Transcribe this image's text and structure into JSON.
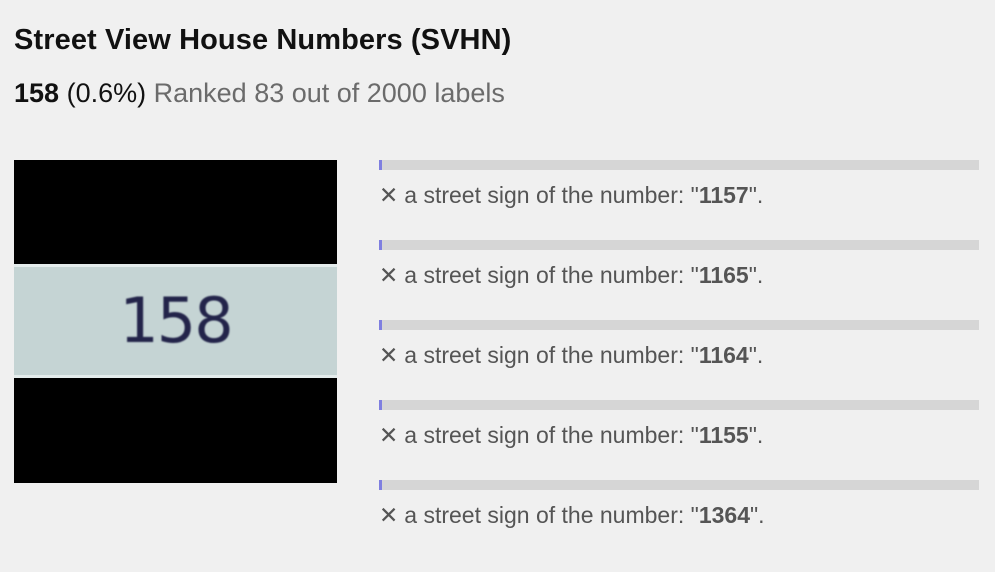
{
  "header": {
    "title": "Street View House Numbers (SVHN)",
    "label": "158",
    "percent": "(0.6%)",
    "rank_text": "Ranked 83 out of 2000 labels"
  },
  "image": {
    "digits": "158"
  },
  "colors": {
    "bar_fill": "#7f7fe0",
    "bar_track": "#d6d6d6"
  },
  "predictions": [
    {
      "icon": "✕",
      "prefix": "a street sign of the number: \"",
      "number": "1157",
      "suffix": "\".",
      "score": 0.004
    },
    {
      "icon": "✕",
      "prefix": "a street sign of the number: \"",
      "number": "1165",
      "suffix": "\".",
      "score": 0.004
    },
    {
      "icon": "✕",
      "prefix": "a street sign of the number: \"",
      "number": "1164",
      "suffix": "\".",
      "score": 0.004
    },
    {
      "icon": "✕",
      "prefix": "a street sign of the number: \"",
      "number": "1155",
      "suffix": "\".",
      "score": 0.004
    },
    {
      "icon": "✕",
      "prefix": "a street sign of the number: \"",
      "number": "1364",
      "suffix": "\".",
      "score": 0.004
    }
  ]
}
